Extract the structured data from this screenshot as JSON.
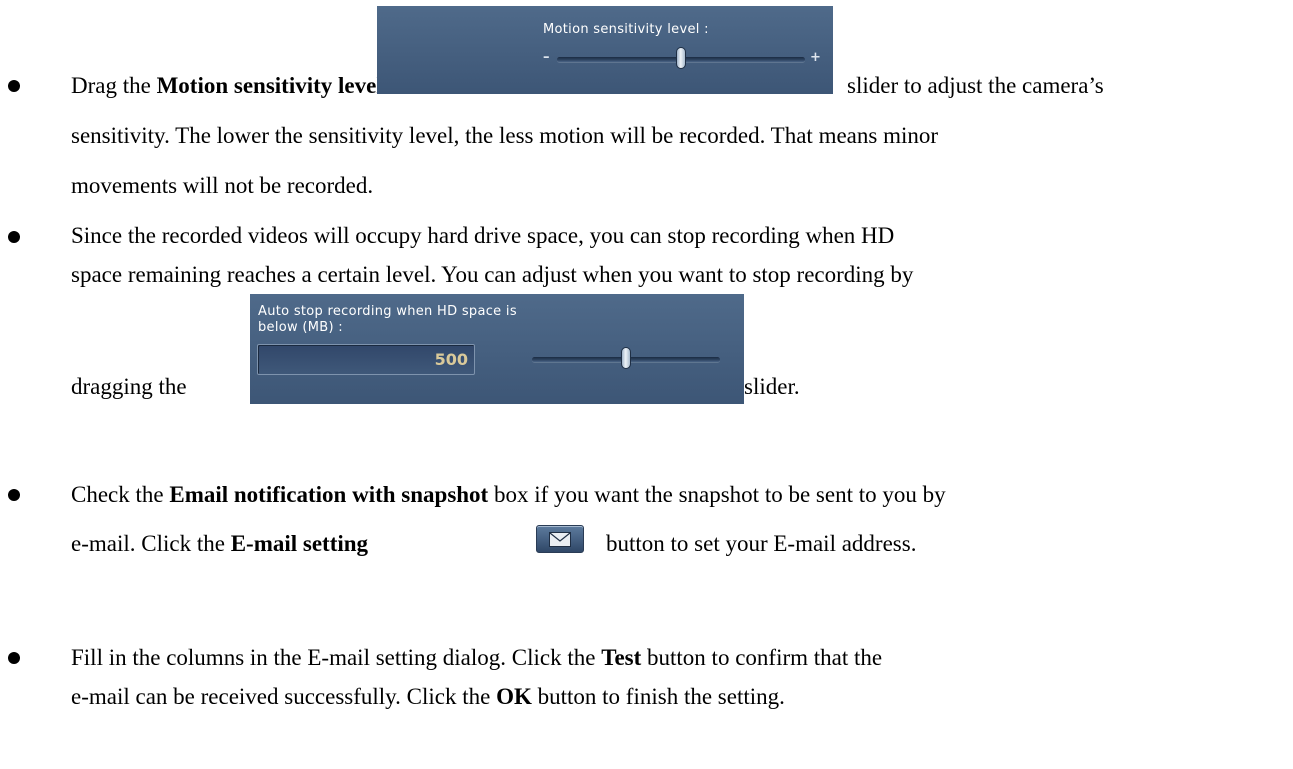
{
  "bullets": [
    {
      "line1_pre": "Drag the ",
      "line1_bold": "Motion sensitivity level",
      "line1_post": "slider to adjust the camera’s",
      "line2": "sensitivity. The lower the sensitivity level, the less motion will be recorded. That means minor",
      "line3": "movements will not be recorded."
    },
    {
      "line1": "Since the recorded videos will occupy hard drive space, you can stop recording when HD",
      "line2": "space remaining reaches a certain level. You can adjust when you want to stop recording by",
      "line3_pre": "dragging the",
      "line3_post": "slider."
    },
    {
      "line1_pre": "Check the ",
      "line1_bold": "Email notification with snapshot",
      "line1_post": " box if you want the snapshot to be sent to you by",
      "line2_pre": "e-mail. Click the ",
      "line2_bold": "E-mail setting",
      "line2_post": "button to set your E-mail address."
    },
    {
      "line1_pre": "Fill in the columns in the E-mail setting dialog. Click the ",
      "line1_bold": "Test",
      "line1_post": " button to confirm that the",
      "line2_pre": "e-mail can be received successfully. Click the ",
      "line2_bold": "OK",
      "line2_post": " button to finish the setting."
    }
  ],
  "motion_widget": {
    "label": "Motion sensitivity level :",
    "minus": "–",
    "plus": "+",
    "level": 0.5
  },
  "autostop_widget": {
    "label_line1": "Auto stop recording when HD space is",
    "label_line2": "below (MB) :",
    "value": "500",
    "level": 0.5
  },
  "email_button": {
    "icon": "envelope-icon"
  },
  "colors": {
    "panel": "#4a6485",
    "knob": "#dfe8f1",
    "value_text": "#d9c99a"
  }
}
